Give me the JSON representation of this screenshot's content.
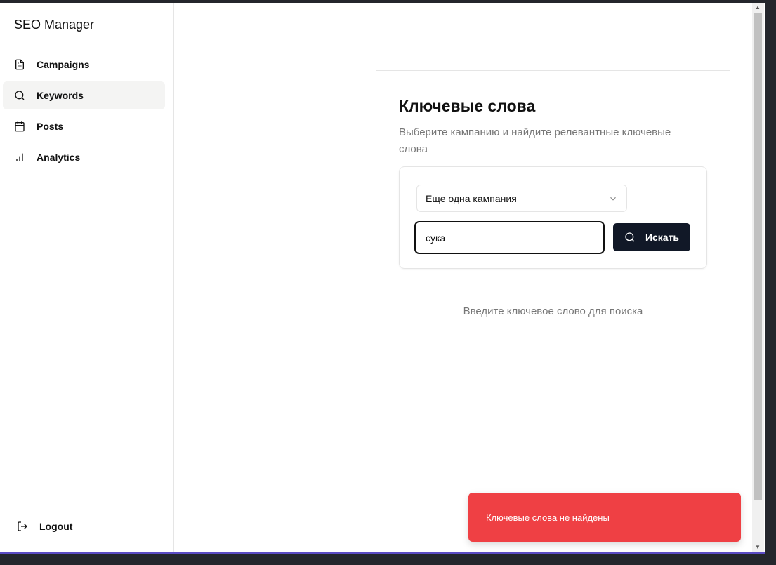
{
  "app": {
    "title": "SEO Manager"
  },
  "sidebar": {
    "items": [
      {
        "label": "Campaigns",
        "icon": "file-text-icon"
      },
      {
        "label": "Keywords",
        "icon": "search-icon",
        "active": true
      },
      {
        "label": "Posts",
        "icon": "calendar-icon"
      },
      {
        "label": "Analytics",
        "icon": "bar-chart-icon"
      }
    ],
    "logout": "Logout"
  },
  "main": {
    "title": "Ключевые слова",
    "subtitle": "Выберите кампанию и найдите релевантные ключевые слова",
    "campaign_select": "Еще одна кампания",
    "search_value": "сука",
    "search_button": "Искать",
    "empty_hint": "Введите ключевое слово для поиска"
  },
  "toast": {
    "message": "Ключевые слова не найдены",
    "color": "#ef4044"
  }
}
